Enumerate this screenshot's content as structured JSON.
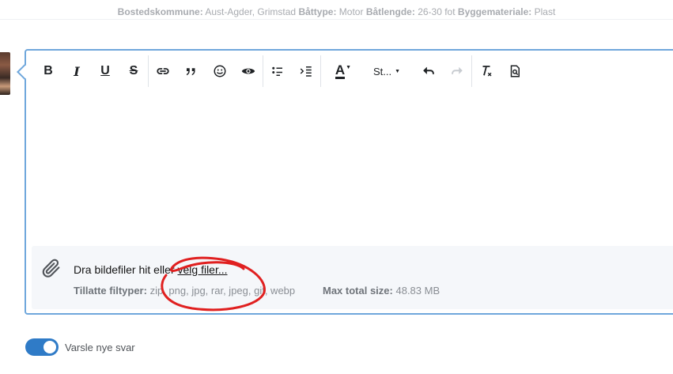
{
  "info": {
    "kommune_label": "Bostedskommune:",
    "kommune_value": "Aust-Agder, Grimstad",
    "type_label": "Båttype:",
    "type_value": "Motor",
    "length_label": "Båtlengde:",
    "length_value": "26-30 fot",
    "material_label": "Byggemateriale:",
    "material_value": "Plast"
  },
  "toolbar": {
    "bold": "B",
    "italic": "I",
    "underline": "U",
    "strike": "S",
    "font_color": "A",
    "style_label": "St..."
  },
  "attach": {
    "drop_text": "Dra bildefiler hit eller ",
    "choose_link": "velg filer...",
    "types_label": "Tillatte filtyper:",
    "types_value": "zip, png, jpg, rar, jpeg, gif, webp",
    "max_label": "Max total size:",
    "max_value": "48.83 MB"
  },
  "toggle": {
    "label": "Varsle nye svar",
    "on": true
  },
  "colors": {
    "accent": "#2f7bc7",
    "editor_border": "#6fa7dc",
    "annotation": "#e02020"
  }
}
